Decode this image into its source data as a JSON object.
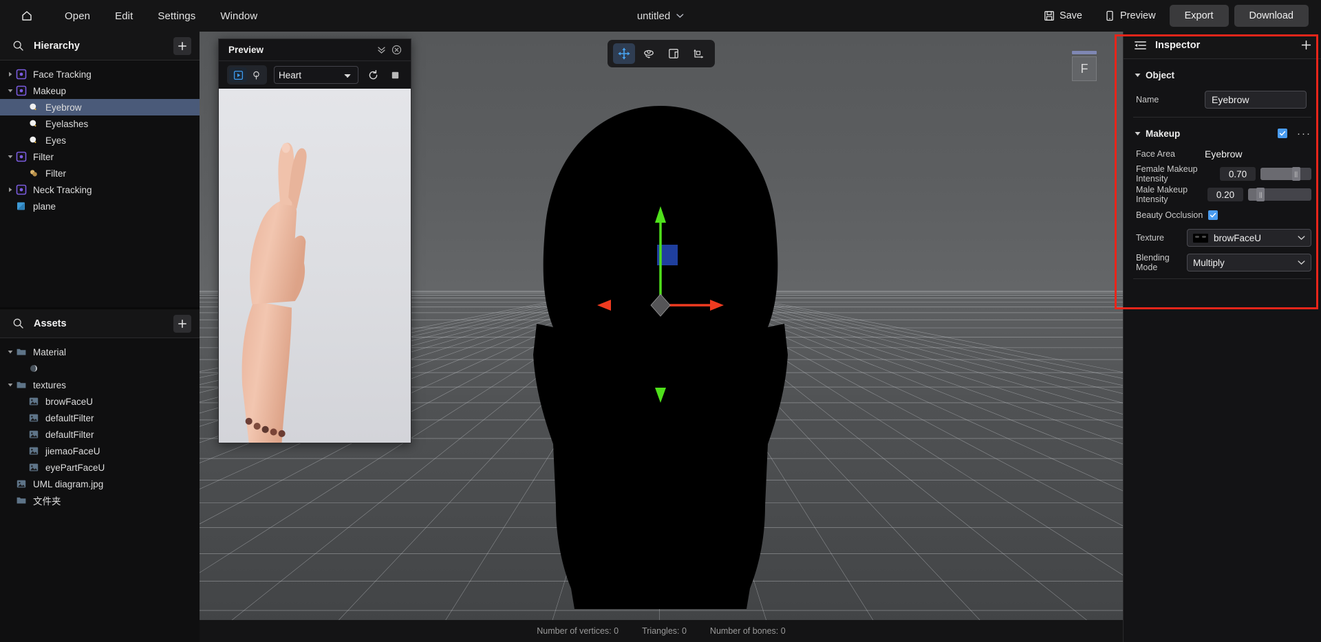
{
  "topbar": {
    "home_icon": "home-icon",
    "menu": [
      "Open",
      "Edit",
      "Settings",
      "Window"
    ],
    "document_title": "untitled",
    "save_label": "Save",
    "save_icon": "floppy-disk-icon",
    "preview_label": "Preview",
    "preview_icon": "phone-icon",
    "export_label": "Export",
    "download_label": "Download"
  },
  "hierarchy": {
    "title": "Hierarchy",
    "search_icon": "search-icon",
    "add_icon": "plus-icon",
    "items": [
      {
        "label": "Face Tracking",
        "depth": 0,
        "caret": "collapsed",
        "icon": "node-icon",
        "selected": false
      },
      {
        "label": "Makeup",
        "depth": 0,
        "caret": "expanded",
        "icon": "node-icon",
        "selected": false
      },
      {
        "label": "Eyebrow",
        "depth": 1,
        "caret": "none",
        "icon": "makeup-icon",
        "selected": true
      },
      {
        "label": "Eyelashes",
        "depth": 1,
        "caret": "none",
        "icon": "makeup-icon",
        "selected": false
      },
      {
        "label": "Eyes",
        "depth": 1,
        "caret": "none",
        "icon": "makeup-icon",
        "selected": false
      },
      {
        "label": "Filter",
        "depth": 0,
        "caret": "expanded",
        "icon": "node-icon",
        "selected": false
      },
      {
        "label": "Filter",
        "depth": 1,
        "caret": "none",
        "icon": "filter-icon",
        "selected": false
      },
      {
        "label": "Neck Tracking",
        "depth": 0,
        "caret": "collapsed",
        "icon": "node-icon",
        "selected": false
      },
      {
        "label": "plane",
        "depth": 0,
        "caret": "none",
        "icon": "plane-icon",
        "selected": false
      }
    ]
  },
  "assets": {
    "title": "Assets",
    "search_icon": "search-icon",
    "add_icon": "plus-icon",
    "items": [
      {
        "label": "Material",
        "depth": 0,
        "caret": "expanded",
        "icon": "folder-icon"
      },
      {
        "label": "",
        "depth": 1,
        "caret": "none",
        "icon": "material-sphere-icon"
      },
      {
        "label": "textures",
        "depth": 0,
        "caret": "expanded",
        "icon": "folder-icon"
      },
      {
        "label": "browFaceU",
        "depth": 1,
        "caret": "none",
        "icon": "image-icon"
      },
      {
        "label": "defaultFilter",
        "depth": 1,
        "caret": "none",
        "icon": "image-icon"
      },
      {
        "label": "defaultFilter",
        "depth": 1,
        "caret": "none",
        "icon": "image-icon"
      },
      {
        "label": "jiemaoFaceU",
        "depth": 1,
        "caret": "none",
        "icon": "image-icon"
      },
      {
        "label": "eyePartFaceU",
        "depth": 1,
        "caret": "none",
        "icon": "image-icon"
      },
      {
        "label": "UML diagram.jpg",
        "depth": 0,
        "caret": "none",
        "icon": "image-icon"
      },
      {
        "label": "文件夹",
        "depth": 0,
        "caret": "none",
        "icon": "folder-icon"
      }
    ]
  },
  "preview_window": {
    "title": "Preview",
    "collapse_icon": "chevrons-down-icon",
    "close_icon": "close-circle-icon",
    "mode_play_icon": "play-box-icon",
    "mode_light_icon": "lightbulb-icon",
    "active_mode": "play",
    "effect_selected": "Heart",
    "effect_options": [
      "Heart"
    ],
    "refresh_icon": "refresh-icon",
    "stop_icon": "stop-square-icon",
    "stage_alt": "hand-gesture-photo"
  },
  "viewport": {
    "tools": [
      {
        "name": "move-tool",
        "icon": "move-arrows-icon",
        "active": true
      },
      {
        "name": "rotate-tool",
        "icon": "rotate-icon",
        "active": false
      },
      {
        "name": "scale-tool",
        "icon": "scale-square-icon",
        "active": false
      },
      {
        "name": "axis-tool",
        "icon": "axis-icon",
        "active": false
      }
    ],
    "view_gizmo_label": "F",
    "status": {
      "vertices": "Number of vertices: 0",
      "triangles": "Triangles: 0",
      "bones": "Number of bones: 0"
    },
    "gizmo_colors": {
      "x_axis": "#ef3b20",
      "y_axis": "#4fe01b",
      "z_plane": "#1f3f9e"
    }
  },
  "inspector": {
    "title": "Inspector",
    "panel_icon": "inspector-list-icon",
    "add_icon": "plus-icon",
    "object_section": {
      "title": "Object",
      "name_label": "Name",
      "name_value": "Eyebrow",
      "name_placeholder": "Name"
    },
    "makeup_section": {
      "title": "Makeup",
      "enabled": true,
      "more_icon": "ellipsis-icon",
      "face_area_label": "Face Area",
      "face_area_value": "Eyebrow",
      "female_intensity_label": "Female Makeup Intensity",
      "female_intensity_value": "0.70",
      "female_intensity_pct": 70,
      "male_intensity_label": "Male Makeup Intensity",
      "male_intensity_value": "0.20",
      "male_intensity_pct": 20,
      "beauty_occlusion_label": "Beauty Occlusion",
      "beauty_occlusion_checked": true,
      "texture_label": "Texture",
      "texture_value": "browFaceU",
      "blending_mode_label": "Blending Mode",
      "blending_mode_value": "Multiply"
    },
    "highlight_color": "#e8251a"
  }
}
